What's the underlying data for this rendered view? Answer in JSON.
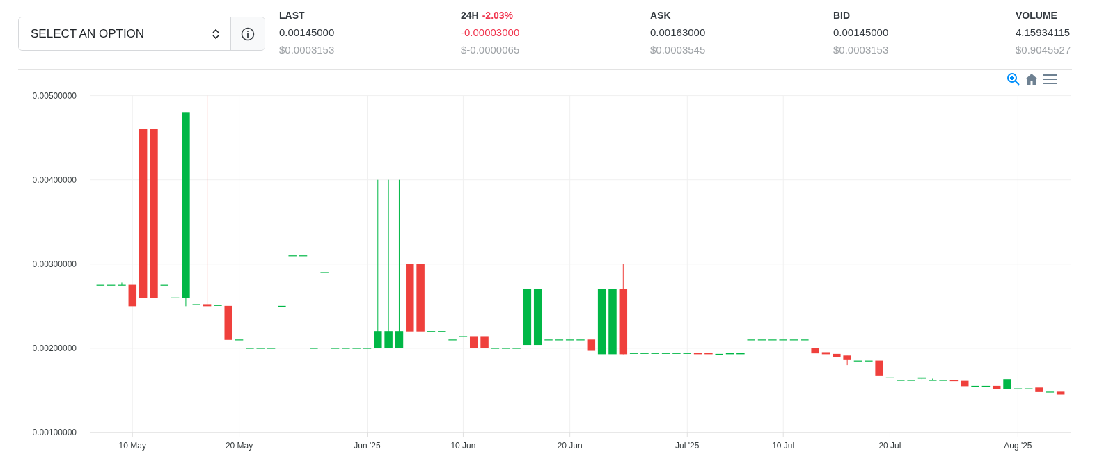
{
  "selector": {
    "value": "SELECT AN OPTION"
  },
  "stats": [
    {
      "label": "LAST",
      "value": "0.00145000",
      "usd": "$0.0003153",
      "negative": false
    },
    {
      "label": "24H",
      "change": "-2.03%",
      "value": "-0.00003000",
      "usd": "$-0.0000065",
      "negative": true
    },
    {
      "label": "ASK",
      "value": "0.00163000",
      "usd": "$0.0003545",
      "negative": false
    },
    {
      "label": "BID",
      "value": "0.00145000",
      "usd": "$0.0003153",
      "negative": false
    },
    {
      "label": "VOLUME",
      "value": "4.15934115",
      "usd": "$0.9045527",
      "negative": false
    }
  ],
  "chart_data": {
    "type": "candlestick",
    "grid": true,
    "x": [
      "2025-05-07",
      "2025-05-08",
      "2025-05-09",
      "2025-05-10",
      "2025-05-11",
      "2025-05-12",
      "2025-05-13",
      "2025-05-14",
      "2025-05-15",
      "2025-05-16",
      "2025-05-17",
      "2025-05-18",
      "2025-05-19",
      "2025-05-20",
      "2025-05-21",
      "2025-05-22",
      "2025-05-23",
      "2025-05-24",
      "2025-05-25",
      "2025-05-26",
      "2025-05-27",
      "2025-05-28",
      "2025-05-29",
      "2025-05-30",
      "2025-05-31",
      "2025-06-01",
      "2025-06-02",
      "2025-06-03",
      "2025-06-04",
      "2025-06-05",
      "2025-06-06",
      "2025-06-07",
      "2025-06-08",
      "2025-06-09",
      "2025-06-10",
      "2025-06-11",
      "2025-06-12",
      "2025-06-13",
      "2025-06-14",
      "2025-06-15",
      "2025-06-16",
      "2025-06-17",
      "2025-06-18",
      "2025-06-19",
      "2025-06-20",
      "2025-06-21",
      "2025-06-22",
      "2025-06-23",
      "2025-06-24",
      "2025-06-25",
      "2025-06-26",
      "2025-06-27",
      "2025-06-28",
      "2025-06-29",
      "2025-06-30",
      "2025-07-01",
      "2025-07-02",
      "2025-07-03",
      "2025-07-04",
      "2025-07-05",
      "2025-07-06",
      "2025-07-07",
      "2025-07-08",
      "2025-07-09",
      "2025-07-10",
      "2025-07-11",
      "2025-07-12",
      "2025-07-13",
      "2025-07-14",
      "2025-07-15",
      "2025-07-16",
      "2025-07-17",
      "2025-07-18",
      "2025-07-19",
      "2025-07-20",
      "2025-07-21",
      "2025-07-22",
      "2025-07-23",
      "2025-07-24",
      "2025-07-25",
      "2025-07-26",
      "2025-07-27",
      "2025-07-28",
      "2025-07-29",
      "2025-07-30",
      "2025-07-31",
      "2025-08-01",
      "2025-08-02",
      "2025-08-03",
      "2025-08-04",
      "2025-08-05"
    ],
    "ohlc": [
      [
        0.00275,
        0.00275,
        0.00275,
        0.00275
      ],
      [
        0.00275,
        0.00275,
        0.00275,
        0.00275
      ],
      [
        0.00275,
        0.00278,
        0.00275,
        0.00275
      ],
      [
        0.00275,
        0.00275,
        0.0025,
        0.0025
      ],
      [
        0.0046,
        0.0046,
        0.0026,
        0.0026
      ],
      [
        0.0046,
        0.0046,
        0.0026,
        0.0026
      ],
      [
        0.00275,
        0.00275,
        0.00275,
        0.00275
      ],
      [
        0.0026,
        0.0026,
        0.0026,
        0.0026
      ],
      [
        0.0026,
        0.0048,
        0.0025,
        0.0048
      ],
      [
        0.00252,
        0.00252,
        0.00252,
        0.00252
      ],
      [
        0.00252,
        0.005,
        0.0025,
        0.0025
      ],
      [
        0.00251,
        0.00251,
        0.00251,
        0.00251
      ],
      [
        0.0025,
        0.0025,
        0.0021,
        0.0021
      ],
      [
        0.0021,
        0.0021,
        0.0021,
        0.0021
      ],
      [
        0.002,
        0.002,
        0.002,
        0.002
      ],
      [
        0.002,
        0.002,
        0.002,
        0.002
      ],
      [
        0.002,
        0.002,
        0.002,
        0.002
      ],
      [
        0.0025,
        0.0025,
        0.0025,
        0.0025
      ],
      [
        0.0031,
        0.0031,
        0.0031,
        0.0031
      ],
      [
        0.0031,
        0.0031,
        0.0031,
        0.0031
      ],
      [
        0.002,
        0.002,
        0.002,
        0.002
      ],
      [
        0.0029,
        0.0029,
        0.0029,
        0.0029
      ],
      [
        0.002,
        0.002,
        0.002,
        0.002
      ],
      [
        0.002,
        0.002,
        0.002,
        0.002
      ],
      [
        0.002,
        0.002,
        0.002,
        0.002
      ],
      [
        0.002,
        0.002,
        0.002,
        0.002
      ],
      [
        0.002,
        0.004,
        0.002,
        0.0022
      ],
      [
        0.002,
        0.004,
        0.002,
        0.0022
      ],
      [
        0.002,
        0.004,
        0.002,
        0.0022
      ],
      [
        0.003,
        0.003,
        0.0022,
        0.0022
      ],
      [
        0.003,
        0.003,
        0.0022,
        0.0022
      ],
      [
        0.0022,
        0.0022,
        0.0022,
        0.0022
      ],
      [
        0.0022,
        0.0022,
        0.0022,
        0.0022
      ],
      [
        0.0021,
        0.0021,
        0.0021,
        0.0021
      ],
      [
        0.00214,
        0.00214,
        0.00214,
        0.00214
      ],
      [
        0.00214,
        0.00214,
        0.002,
        0.002
      ],
      [
        0.00214,
        0.00214,
        0.002,
        0.002
      ],
      [
        0.002,
        0.002,
        0.002,
        0.002
      ],
      [
        0.002,
        0.002,
        0.002,
        0.002
      ],
      [
        0.002,
        0.002,
        0.002,
        0.002
      ],
      [
        0.00204,
        0.0027,
        0.00204,
        0.0027
      ],
      [
        0.00204,
        0.0027,
        0.00204,
        0.0027
      ],
      [
        0.0021,
        0.0021,
        0.0021,
        0.0021
      ],
      [
        0.0021,
        0.0021,
        0.0021,
        0.0021
      ],
      [
        0.0021,
        0.0021,
        0.0021,
        0.0021
      ],
      [
        0.0021,
        0.0021,
        0.0021,
        0.0021
      ],
      [
        0.0021,
        0.0021,
        0.00197,
        0.00197
      ],
      [
        0.00193,
        0.0027,
        0.00193,
        0.0027
      ],
      [
        0.00193,
        0.0027,
        0.00193,
        0.0027
      ],
      [
        0.0027,
        0.003,
        0.00193,
        0.00193
      ],
      [
        0.00194,
        0.00194,
        0.00194,
        0.00194
      ],
      [
        0.00194,
        0.00194,
        0.00194,
        0.00194
      ],
      [
        0.00194,
        0.00194,
        0.00194,
        0.00194
      ],
      [
        0.00194,
        0.00194,
        0.00194,
        0.00194
      ],
      [
        0.00194,
        0.00194,
        0.00194,
        0.00194
      ],
      [
        0.00194,
        0.00194,
        0.00194,
        0.00194
      ],
      [
        0.00194,
        0.00194,
        0.00193,
        0.00193
      ],
      [
        0.00194,
        0.00194,
        0.00193,
        0.00193
      ],
      [
        0.00193,
        0.00193,
        0.00193,
        0.00193
      ],
      [
        0.00193,
        0.00194,
        0.00193,
        0.00194
      ],
      [
        0.00193,
        0.00194,
        0.00193,
        0.00194
      ],
      [
        0.0021,
        0.0021,
        0.0021,
        0.0021
      ],
      [
        0.0021,
        0.0021,
        0.0021,
        0.0021
      ],
      [
        0.0021,
        0.0021,
        0.0021,
        0.0021
      ],
      [
        0.0021,
        0.0021,
        0.0021,
        0.0021
      ],
      [
        0.0021,
        0.0021,
        0.0021,
        0.0021
      ],
      [
        0.0021,
        0.0021,
        0.0021,
        0.0021
      ],
      [
        0.002,
        0.002,
        0.00194,
        0.00194
      ],
      [
        0.00195,
        0.00195,
        0.00193,
        0.00193
      ],
      [
        0.00193,
        0.00193,
        0.0019,
        0.0019
      ],
      [
        0.00191,
        0.00191,
        0.0018,
        0.00186
      ],
      [
        0.00185,
        0.00185,
        0.00185,
        0.00185
      ],
      [
        0.00185,
        0.00185,
        0.00185,
        0.00185
      ],
      [
        0.00185,
        0.00185,
        0.00167,
        0.00167
      ],
      [
        0.00165,
        0.00165,
        0.00165,
        0.00165
      ],
      [
        0.00162,
        0.00162,
        0.00162,
        0.00162
      ],
      [
        0.00162,
        0.00162,
        0.00162,
        0.00162
      ],
      [
        0.00164,
        0.00165,
        0.00163,
        0.00165
      ],
      [
        0.00162,
        0.00164,
        0.00162,
        0.00162
      ],
      [
        0.00162,
        0.00162,
        0.00162,
        0.00162
      ],
      [
        0.00162,
        0.00162,
        0.00161,
        0.00161
      ],
      [
        0.00161,
        0.00161,
        0.00155,
        0.00155
      ],
      [
        0.00155,
        0.00155,
        0.00155,
        0.00155
      ],
      [
        0.00155,
        0.00155,
        0.00155,
        0.00155
      ],
      [
        0.00155,
        0.00155,
        0.00152,
        0.00152
      ],
      [
        0.00152,
        0.00163,
        0.00152,
        0.00163
      ],
      [
        0.00152,
        0.00152,
        0.00152,
        0.00152
      ],
      [
        0.00152,
        0.00152,
        0.00152,
        0.00152
      ],
      [
        0.00153,
        0.00153,
        0.00148,
        0.00148
      ],
      [
        0.00148,
        0.00148,
        0.00148,
        0.00148
      ],
      [
        0.00148,
        0.00148,
        0.00145,
        0.00145
      ]
    ],
    "xlim": [
      "2025-05-06",
      "2025-08-06"
    ],
    "ylim": [
      0.001,
      0.005
    ],
    "yticks": [
      {
        "value": 0.001,
        "label": "0.00100000"
      },
      {
        "value": 0.002,
        "label": "0.00200000"
      },
      {
        "value": 0.003,
        "label": "0.00300000"
      },
      {
        "value": 0.004,
        "label": "0.00400000"
      },
      {
        "value": 0.005,
        "label": "0.00500000"
      }
    ],
    "xticks": [
      {
        "value": "2025-05-10",
        "label": "10 May"
      },
      {
        "value": "2025-05-20",
        "label": "20 May"
      },
      {
        "value": "2025-06-01",
        "label": "Jun '25"
      },
      {
        "value": "2025-06-10",
        "label": "10 Jun"
      },
      {
        "value": "2025-06-20",
        "label": "20 Jun"
      },
      {
        "value": "2025-07-01",
        "label": "Jul '25"
      },
      {
        "value": "2025-07-10",
        "label": "10 Jul"
      },
      {
        "value": "2025-07-20",
        "label": "20 Jul"
      },
      {
        "value": "2025-08-01",
        "label": "Aug '25"
      }
    ]
  }
}
